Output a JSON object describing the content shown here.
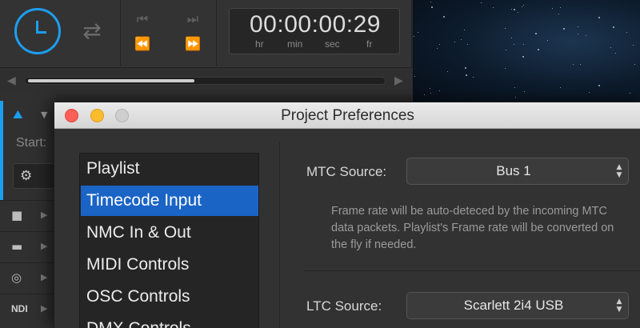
{
  "timecode": {
    "value": "00:00:00:29",
    "units": [
      "hr",
      "min",
      "sec",
      "fr"
    ]
  },
  "scrubber": {
    "progress": 0.47
  },
  "left_panel": {
    "start_label": "Start:",
    "ndi_label": "NDI"
  },
  "dialog": {
    "title": "Project Preferences",
    "nav_items": [
      "Playlist",
      "Timecode Input",
      "NMC In & Out",
      "MIDI Controls",
      "OSC Controls",
      "DMX Controls"
    ],
    "selected_index": 1,
    "mtc": {
      "label": "MTC Source:",
      "value": "Bus 1",
      "help": "Frame rate will be auto-deteced by the incoming MTC data packets. Playlist's Frame rate will be converted on the fly if needed."
    },
    "ltc": {
      "label": "LTC Source:",
      "value": "Scarlett 2i4 USB"
    }
  },
  "colors": {
    "accent": "#1c9ef0",
    "selection": "#1a64c6",
    "close": "#fc5f57",
    "minimize": "#fdbc2e",
    "zoom": "#cfcfcf"
  }
}
